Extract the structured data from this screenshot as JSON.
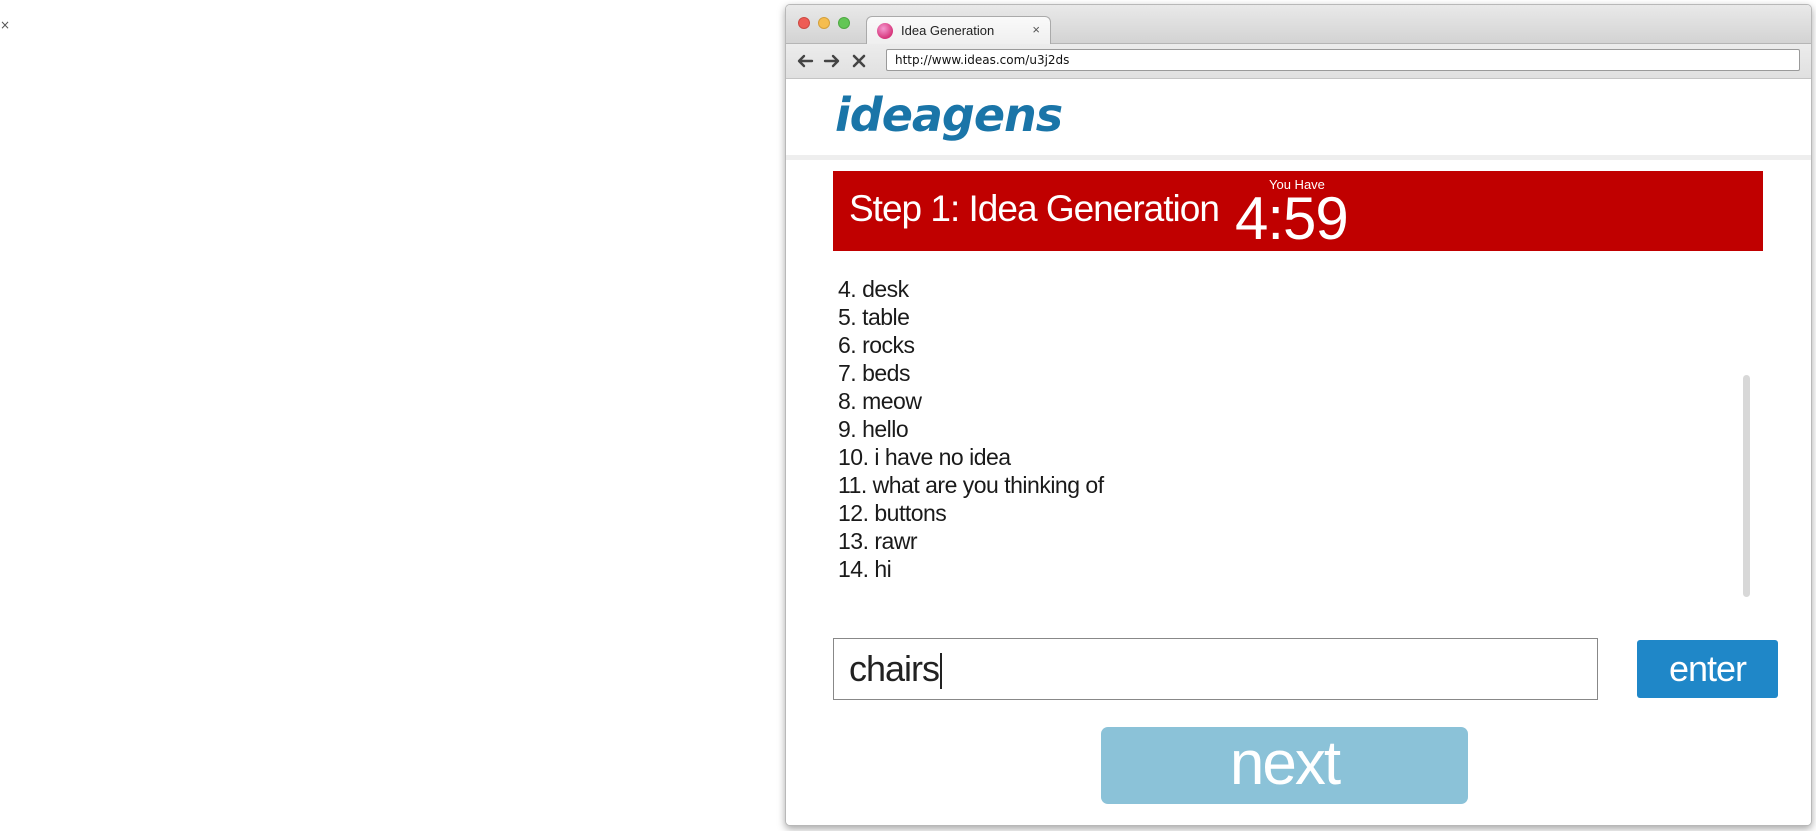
{
  "page": {
    "close_glyph": "×"
  },
  "browser": {
    "tab": {
      "title": "Idea Generation",
      "close_glyph": "×",
      "favicon": "pink-orb-icon"
    },
    "toolbar": {
      "back_icon": "back-arrow-icon",
      "forward_icon": "forward-arrow-icon",
      "stop_icon": "stop-icon",
      "url": "http://www.ideas.com/u3j2ds"
    }
  },
  "site": {
    "logo": "ideagens",
    "colors": {
      "logo": "#1a75a8",
      "banner": "#c00000",
      "enter_button": "#1f87c8",
      "next_button": "#8bc2d8"
    }
  },
  "banner": {
    "title": "Step 1: Idea Generation",
    "timer_label": "You Have",
    "timer_value": "4:59"
  },
  "ideas": [
    "4. desk",
    "5. table",
    "6. rocks",
    "7. beds",
    "8. meow",
    "9. hello",
    "10. i have no idea",
    "11. what are you thinking of",
    "12. buttons",
    "13. rawr",
    "14. hi"
  ],
  "input": {
    "value": "chairs"
  },
  "buttons": {
    "enter": "enter",
    "next": "next"
  }
}
